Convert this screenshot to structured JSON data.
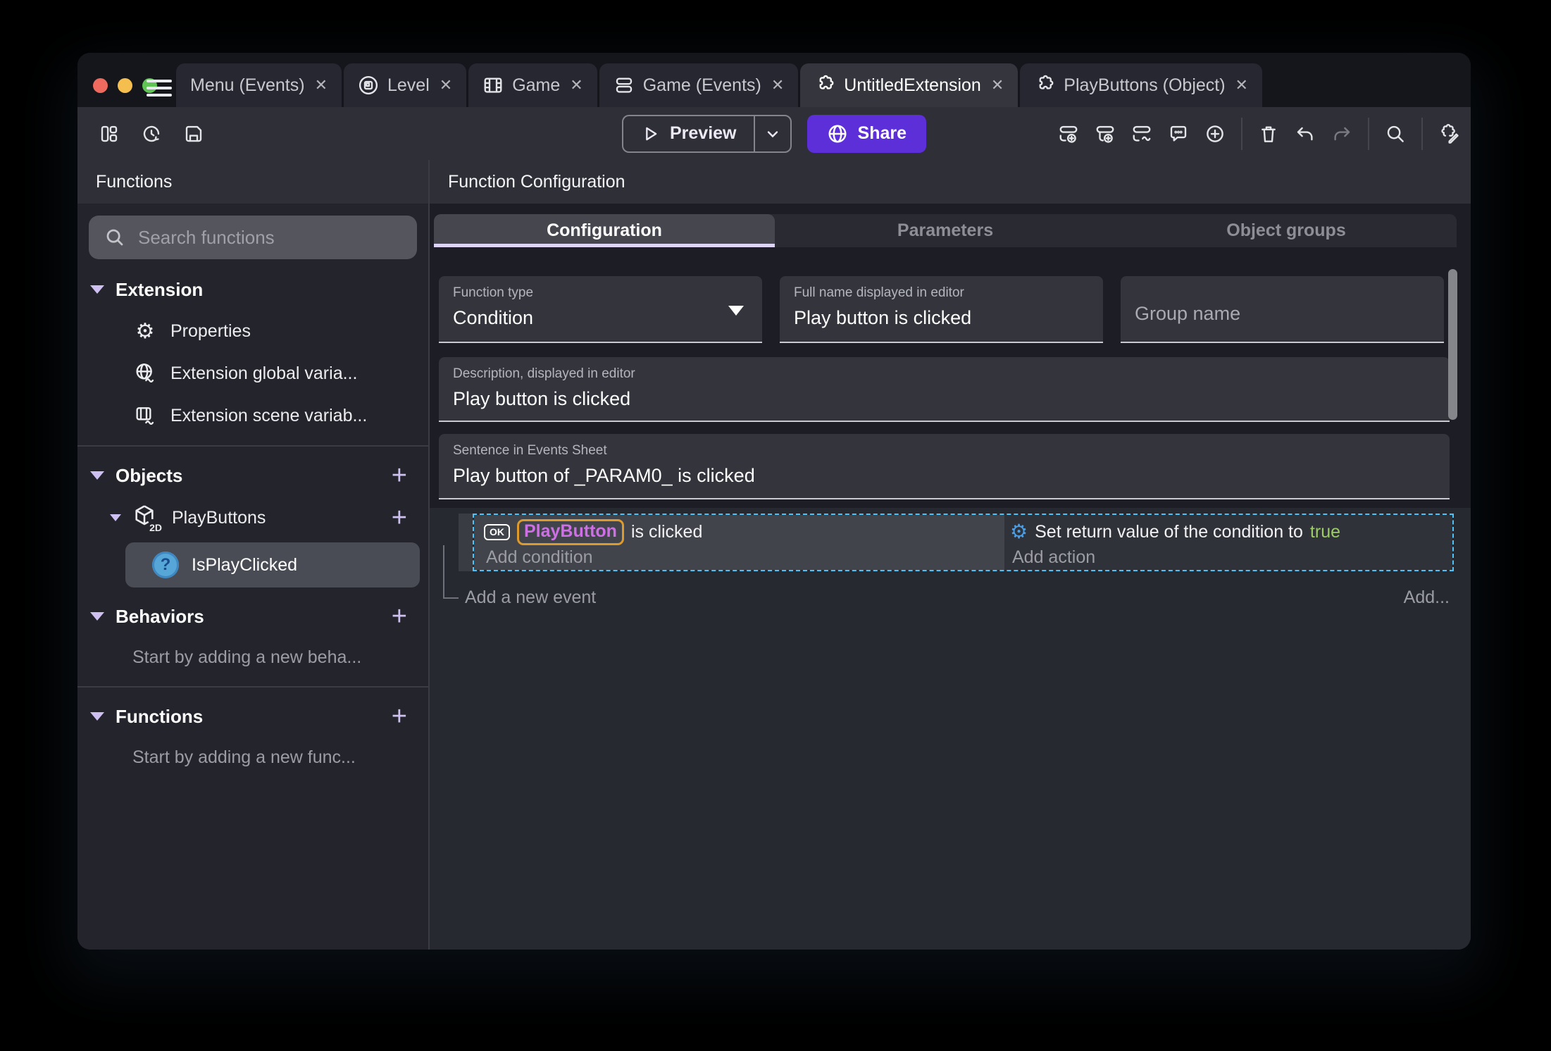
{
  "glyphs": {
    "close": "✕",
    "plus": "+",
    "gear": "⚙",
    "question": "?",
    "two_d": "2D"
  },
  "tabs": [
    {
      "label": "Menu (Events)"
    },
    {
      "label": "Level"
    },
    {
      "label": "Game"
    },
    {
      "label": "Game (Events)"
    },
    {
      "label": "UntitledExtension"
    },
    {
      "label": "PlayButtons (Object)"
    }
  ],
  "toolbar": {
    "preview": "Preview",
    "share": "Share"
  },
  "sidebar": {
    "title": "Functions",
    "search_placeholder": "Search functions",
    "extension": {
      "title": "Extension",
      "items": [
        "Properties",
        "Extension global varia...",
        "Extension scene variab..."
      ]
    },
    "objects": {
      "title": "Objects",
      "object": "PlayButtons",
      "function": "IsPlayClicked"
    },
    "behaviors": {
      "title": "Behaviors",
      "empty": "Start by adding a new beha..."
    },
    "functions": {
      "title": "Functions",
      "empty": "Start by adding a new func..."
    }
  },
  "main": {
    "header": "Function Configuration",
    "tabs": [
      "Configuration",
      "Parameters",
      "Object groups"
    ],
    "fields": {
      "function_type": {
        "label": "Function type",
        "value": "Condition"
      },
      "full_name": {
        "label": "Full name displayed in editor",
        "value": "Play button is clicked"
      },
      "group_name": {
        "label": "Group name",
        "value": ""
      },
      "description": {
        "label": "Description, displayed in editor",
        "value": "Play button is clicked"
      },
      "sentence": {
        "label": "Sentence in Events Sheet",
        "value": "Play button of _PARAM0_ is clicked"
      }
    },
    "events": {
      "condition": {
        "badge": "OK",
        "object": "PlayButton",
        "text": "is clicked",
        "placeholder": "Add condition"
      },
      "action": {
        "text": "Set return value of the condition to",
        "value": "true",
        "placeholder": "Add action"
      },
      "add_event": "Add a new event",
      "add_more": "Add..."
    }
  },
  "colors": {
    "accent_purple": "#5c2fd9",
    "lavender": "#cfc0f2",
    "selection_blue": "#4fc3f7",
    "object_name": "#cf6fe6",
    "object_highlight": "#dd9b2d",
    "boolean_true": "#9ccc65"
  }
}
